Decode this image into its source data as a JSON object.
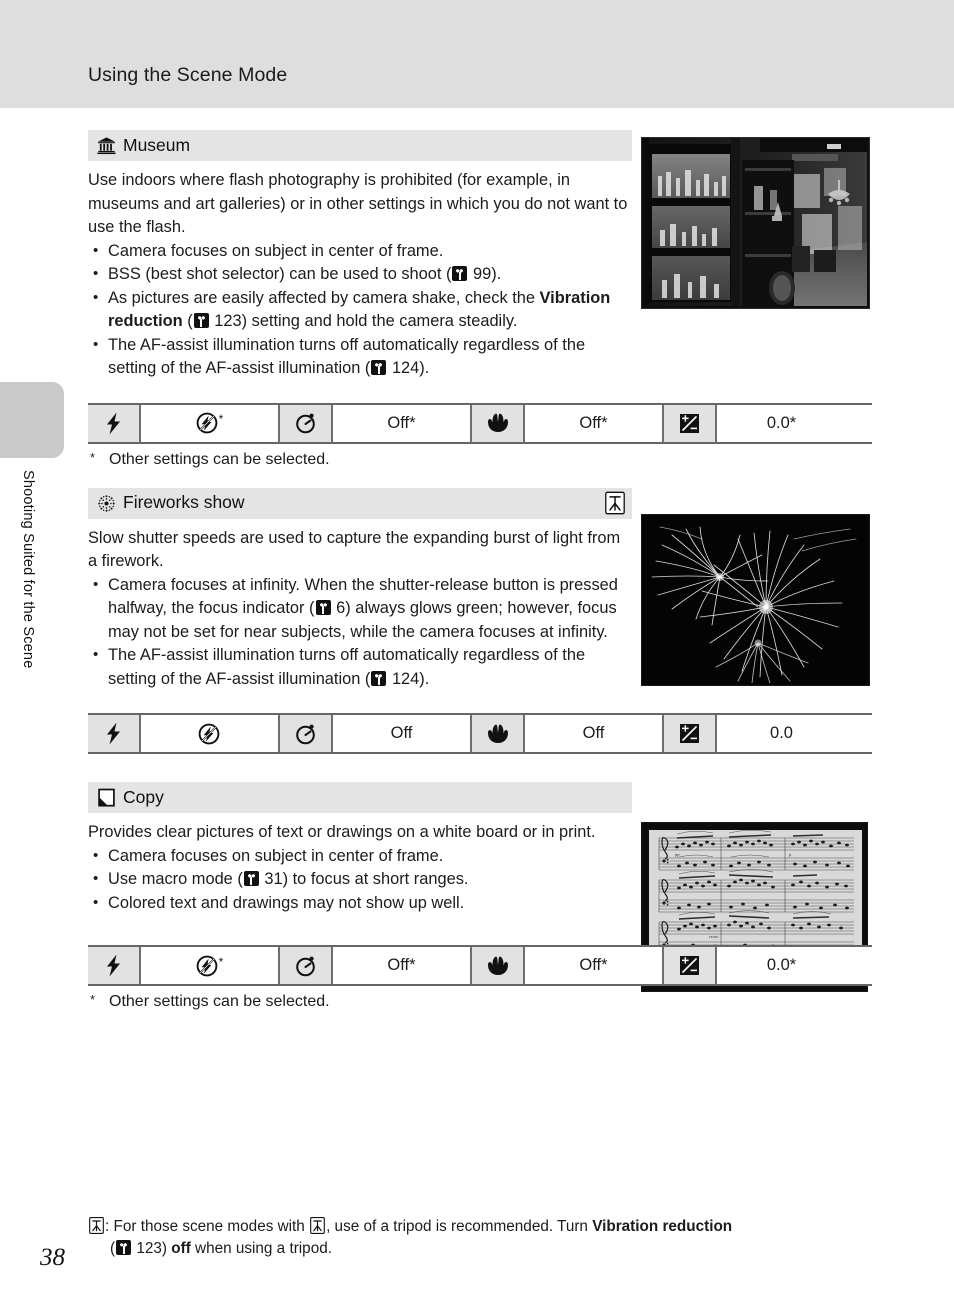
{
  "header": {
    "title": "Using the Scene Mode"
  },
  "side_tab": {
    "label": "Shooting Suited for the Scene"
  },
  "page_number": "38",
  "sections": [
    {
      "id": "museum",
      "icon": "museum-icon",
      "title": "Museum",
      "tripod": false,
      "intro": "Use indoors where flash photography is prohibited (for example, in museums and art galleries) or in other settings in which you do not want to use the flash.",
      "bullets": [
        {
          "pre": "Camera focuses on subject in center of frame.",
          "ref": null,
          "post": ""
        },
        {
          "pre": "BSS (best shot selector) can be used to shoot (",
          "ref": "99",
          "post": ")."
        },
        {
          "pre": "As pictures are easily affected by camera shake, check the ",
          "bold": "Vibration reduction",
          "mid": " (",
          "ref": "123",
          "post": ") setting and hold the camera steadily."
        },
        {
          "pre": "The AF-assist illumination turns off automatically regardless of the setting of the AF-assist illumination (",
          "ref": "124",
          "post": ")."
        }
      ],
      "settings": {
        "flash_mode": {
          "icon": "flash-bolt-icon",
          "value_icon": "flash-off-icon",
          "value_star": "*"
        },
        "self_timer": {
          "icon": "self-timer-icon",
          "value": "Off*"
        },
        "macro_mode": {
          "icon": "macro-flower-icon",
          "value": "Off*"
        },
        "exposure_comp": {
          "icon": "exposure-compensation-icon",
          "value": "0.0*"
        }
      },
      "footnote": "Other settings can be selected.",
      "footnote_marker": "*",
      "photo_alt": "museum-interior-photo"
    },
    {
      "id": "fireworks",
      "icon": "fireworks-icon",
      "title": "Fireworks show",
      "tripod": true,
      "intro": "Slow shutter speeds are used to capture the expanding burst of light from a firework.",
      "bullets": [
        {
          "pre": "Camera focuses at infinity. When the shutter-release button is pressed halfway, the focus indicator (",
          "ref": "6",
          "post": ") always glows green; however, focus may not be set for near subjects, while the camera focuses at infinity."
        },
        {
          "pre": "The AF-assist illumination turns off automatically regardless of the setting of the AF-assist illumination (",
          "ref": "124",
          "post": ")."
        }
      ],
      "settings": {
        "flash_mode": {
          "icon": "flash-bolt-icon",
          "value_icon": "flash-off-icon",
          "value_star": ""
        },
        "self_timer": {
          "icon": "self-timer-icon",
          "value": "Off"
        },
        "macro_mode": {
          "icon": "macro-flower-icon",
          "value": "Off"
        },
        "exposure_comp": {
          "icon": "exposure-compensation-icon",
          "value": "0.0"
        }
      },
      "footnote": "",
      "footnote_marker": "",
      "photo_alt": "fireworks-burst-photo"
    },
    {
      "id": "copy",
      "icon": "copy-icon",
      "title": "Copy",
      "tripod": false,
      "intro": "Provides clear pictures of text or drawings on a white board or in print.",
      "bullets": [
        {
          "pre": "Camera focuses on subject in center of frame.",
          "ref": null,
          "post": ""
        },
        {
          "pre": "Use macro mode (",
          "ref": "31",
          "post": ") to focus at short ranges."
        },
        {
          "pre": "Colored text and drawings may not show up well.",
          "ref": null,
          "post": ""
        }
      ],
      "settings": {
        "flash_mode": {
          "icon": "flash-bolt-icon",
          "value_icon": "flash-off-icon",
          "value_star": "*"
        },
        "self_timer": {
          "icon": "self-timer-icon",
          "value": "Off*"
        },
        "macro_mode": {
          "icon": "macro-flower-icon",
          "value": "Off*"
        },
        "exposure_comp": {
          "icon": "exposure-compensation-icon",
          "value": "0.0*"
        }
      },
      "footnote": "Other settings can be selected.",
      "footnote_marker": "*",
      "photo_alt": "sheet-music-photo"
    }
  ],
  "bottom_note": {
    "line1_a": ": For those scene modes with ",
    "line1_b": ", use of a tripod is recommended. Turn ",
    "line1_bold": "Vibration reduction",
    "line2_a": "(",
    "line2_ref": "123",
    "line2_b": ") ",
    "line2_bold": "off",
    "line2_c": " when using a tripod."
  },
  "colors": {
    "header_band": "#dedede",
    "section_header": "#e4e4e4",
    "cell_icon_bg": "#e2e2e2",
    "rule": "#666666"
  }
}
